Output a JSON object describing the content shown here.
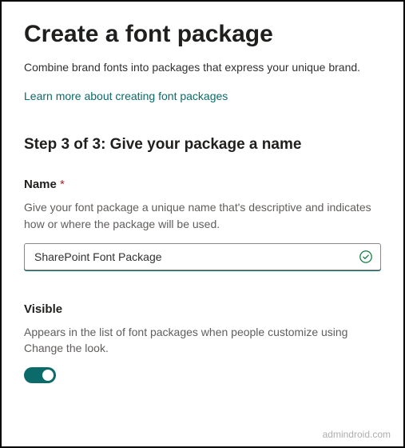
{
  "header": {
    "title": "Create a font package",
    "subtitle": "Combine brand fonts into packages that express your unique brand.",
    "learn_more": "Learn more about creating font packages"
  },
  "step": {
    "heading": "Step 3 of 3: Give your package a name"
  },
  "fields": {
    "name": {
      "label": "Name",
      "required_marker": "*",
      "description": "Give your font package a unique name that's descriptive and indicates how or where the package will be used.",
      "value": "SharePoint Font Package"
    },
    "visible": {
      "label": "Visible",
      "description": "Appears in the list of font packages when people customize using Change the look.",
      "enabled": true
    }
  },
  "watermark": "admindroid.com"
}
